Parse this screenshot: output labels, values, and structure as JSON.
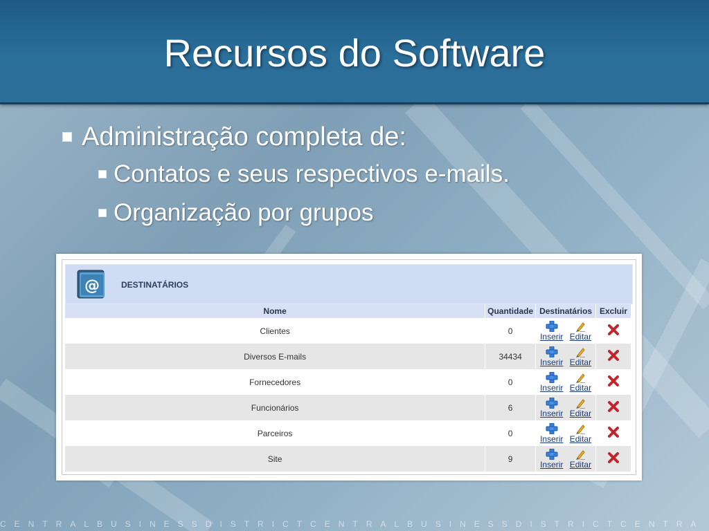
{
  "slide": {
    "title": "Recursos do Software",
    "bullet1": "Administração completa de:",
    "sub1": "Contatos e seus respectivos e-mails.",
    "sub2": "Organização por grupos"
  },
  "panel": {
    "title": "DESTINATÁRIOS",
    "icon": "email-at-icon",
    "columns": {
      "nome": "Nome",
      "quantidade": "Quantidade",
      "destinatarios": "Destinatários",
      "excluir": "Excluir"
    },
    "actions": {
      "inserir": "Inserir",
      "editar": "Editar"
    },
    "rows": [
      {
        "nome": "Clientes",
        "quantidade": "0"
      },
      {
        "nome": "Diversos E-mails",
        "quantidade": "34434"
      },
      {
        "nome": "Fornecedores",
        "quantidade": "0"
      },
      {
        "nome": "Funcionários",
        "quantidade": "6"
      },
      {
        "nome": "Parceiros",
        "quantidade": "0"
      },
      {
        "nome": "Site",
        "quantidade": "9"
      }
    ]
  },
  "footer": {
    "text": "CENTRALBUSINESSDISTRICTCENTRALBUSINESSDISTRICTCENTRA"
  },
  "colors": {
    "header": "#2a6e9a",
    "panel_head": "#cfdcf3",
    "row_alt": "#e6e6e6",
    "delete": "#c0272d",
    "insert": "#3a7fd6"
  }
}
